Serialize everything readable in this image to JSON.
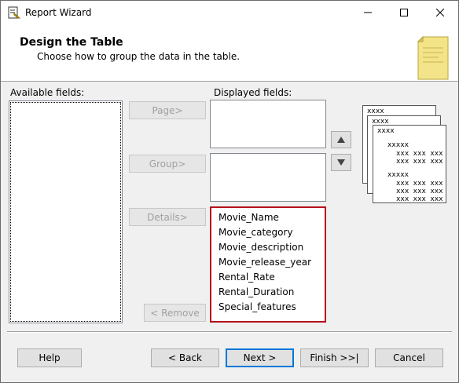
{
  "window": {
    "title": "Report Wizard"
  },
  "header": {
    "title": "Design the Table",
    "subtitle": "Choose how to group the data in the table."
  },
  "available_fields": {
    "label": "Available fields:"
  },
  "displayed_fields": {
    "label": "Displayed fields:",
    "details_items": [
      "Movie_Name",
      "Movie_category",
      "Movie_description",
      "Movie_release_year",
      "Rental_Rate",
      "Rental_Duration",
      "Special_features"
    ]
  },
  "move_buttons": {
    "page": "Page>",
    "group": "Group>",
    "details": "Details>",
    "remove": "< Remove"
  },
  "preview": {
    "header_labels": [
      "xxxx",
      "xxxx",
      "xxxx"
    ],
    "group1": "xxxxx",
    "group1_rows": [
      "xxx xxx xxx",
      "xxx xxx xxx"
    ],
    "group2": "xxxxx",
    "group2_rows": [
      "xxx xxx xxx",
      "xxx xxx xxx",
      "xxx xxx xxx"
    ]
  },
  "footer": {
    "help": "Help",
    "back": "< Back",
    "next": "Next >",
    "finish": "Finish >>|",
    "cancel": "Cancel"
  }
}
